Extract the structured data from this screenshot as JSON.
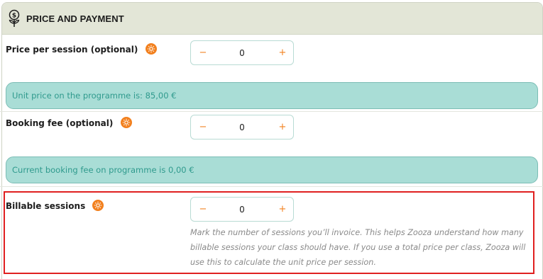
{
  "section": {
    "title": "PRICE AND PAYMENT",
    "icon": "coin-plant-icon"
  },
  "fields": {
    "price_per_session": {
      "label": "Price per session (optional)",
      "value": "0",
      "minus": "−",
      "plus": "+"
    },
    "booking_fee": {
      "label": "Booking fee (optional)",
      "value": "0",
      "minus": "−",
      "plus": "+"
    },
    "billable_sessions": {
      "label": "Billable sessions",
      "value": "0",
      "minus": "−",
      "plus": "+",
      "help": "Mark the number of sessions you’ll invoice. This helps Zooza understand how many billable sessions your class should have. If you use a total price per class, Zooza will use this to calculate the unit price per session."
    }
  },
  "notices": {
    "unit_price": "Unit price on the programme is: 85,00 €",
    "booking_fee": "Current booking fee on programme is 0,00 €"
  },
  "colors": {
    "accent_orange": "#f2801e",
    "notice_bg": "#a9ddd6",
    "notice_text": "#2f9a8d",
    "header_bg": "#e3e6d7",
    "highlight_border": "#e02020"
  }
}
